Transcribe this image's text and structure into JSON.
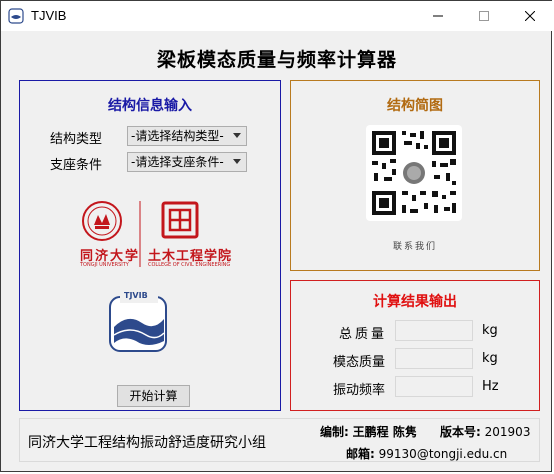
{
  "window": {
    "title": "TJVIB"
  },
  "header": {
    "title": "梁板模态质量与频率计算器"
  },
  "input_panel": {
    "title": "结构信息输入",
    "structure_type": {
      "label": "结构类型",
      "value": "-请选择结构类型-"
    },
    "support": {
      "label": "支座条件",
      "value": "-请选择支座条件-"
    },
    "logo_university": {
      "cn": "同济大学",
      "en": "TONGJI UNIVERSITY"
    },
    "logo_college": {
      "cn": "土木工程学院",
      "en": "COLLEGE OF CIVIL ENGINEERING"
    },
    "logo_tjvib": "TJVIB",
    "start_button": "开始计算"
  },
  "sketch_panel": {
    "title": "结构简图",
    "qr_caption": "联系我们"
  },
  "output_panel": {
    "title": "计算结果输出",
    "rows": [
      {
        "label": "总质量",
        "unit": "kg",
        "value": ""
      },
      {
        "label": "模态质量",
        "unit": "kg",
        "value": ""
      },
      {
        "label": "振动频率",
        "unit": "Hz",
        "value": ""
      }
    ]
  },
  "footer": {
    "group": "同济大学工程结构振动舒适度研究小组",
    "authors_label": "编制:",
    "authors": "王鹏程 陈隽",
    "version_label": "版本号:",
    "version": "201903",
    "email_label": "邮箱:",
    "email": "99130@tongji.edu.cn"
  },
  "colors": {
    "input_border": "#1a1aa6",
    "sketch_border": "#b87a1f",
    "output_border": "#d11f1f",
    "logo_red": "#c3161c",
    "logo_blue": "#2d4a8c"
  }
}
